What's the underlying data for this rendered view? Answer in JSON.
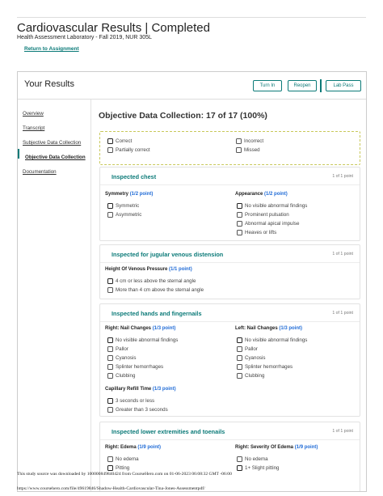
{
  "header": {
    "title": "Cardiovascular Results | Completed",
    "subtitle": "Health Assessment Laboratory - Fall 2019, NUR 305L",
    "return_link": "Return to Assignment"
  },
  "results": {
    "heading": "Your Results",
    "buttons": {
      "turn_in": "Turn In",
      "reopen": "Reopen",
      "lab_pass": "Lab Pass"
    }
  },
  "nav": {
    "items": [
      "Overview",
      "Transcript",
      "Subjective Data Collection",
      "Objective Data Collection",
      "Documentation"
    ]
  },
  "main": {
    "title": "Objective Data Collection: 17 of 17 (100%)"
  },
  "legend": {
    "correct": "Correct",
    "partially_correct": "Partially correct",
    "incorrect": "Incorrect",
    "missed": "Missed"
  },
  "sections": [
    {
      "title": "Inspected chest",
      "points": "1 of 1 point",
      "q1": {
        "label": "Symmetry",
        "score": "(1/2 point)",
        "options": [
          "Symmetric",
          "Asymmetric"
        ]
      },
      "q2": {
        "label": "Appearance",
        "score": "(1/2 point)",
        "options": [
          "No visible abnormal findings",
          "Prominent pulsation",
          "Abnormal apical impulse",
          "Heaves or lifts"
        ]
      }
    },
    {
      "title": "Inspected for jugular venous distension",
      "points": "1 of 1 point",
      "q1": {
        "label": "Height Of Venous Pressure",
        "score": "(1/1 point)",
        "options": [
          "4 cm or less above the sternal angle",
          "More than 4 cm above the sternal angle"
        ]
      }
    },
    {
      "title": "Inspected hands and fingernails",
      "points": "1 of 1 point",
      "q1": {
        "label": "Right: Nail Changes",
        "score": "(1/3 point)",
        "options": [
          "No visible abnormal findings",
          "Pallor",
          "Cyanosis",
          "Splinter hemorrhages",
          "Clubbing"
        ]
      },
      "q2": {
        "label": "Left: Nail Changes",
        "score": "(1/3 point)",
        "options": [
          "No visible abnormal findings",
          "Pallor",
          "Cyanosis",
          "Splinter hemorrhages",
          "Clubbing"
        ]
      },
      "q3": {
        "label": "Capillary Refill Time",
        "score": "(1/3 point)",
        "options": [
          "3 seconds or less",
          "Greater than 3 seconds"
        ]
      }
    },
    {
      "title": "Inspected lower extremities and toenails",
      "points": "1 of 1 point",
      "q1": {
        "label": "Right: Edema",
        "score": "(1/9 point)",
        "options": [
          "No edema",
          "Pitting"
        ]
      },
      "q2": {
        "label": "Right: Severity Of Edema",
        "score": "(1/9 point)",
        "options": [
          "No edema",
          "1+ Slight pitting"
        ]
      }
    }
  ],
  "footer": {
    "download_notice": "This study source was downloaded by 100000849840424 from CourseHero.com on 01-06-2023 06:08:32 GMT -06:00",
    "url": "https://www.coursehero.com/file/49619846/Shadow-Health-Cardiovascular-Tina-Jones-Assessmentpdf/"
  },
  "colors": {
    "accent": "#0b7a78",
    "score": "#1e6ad6",
    "legend_border": "#c8c85a"
  }
}
